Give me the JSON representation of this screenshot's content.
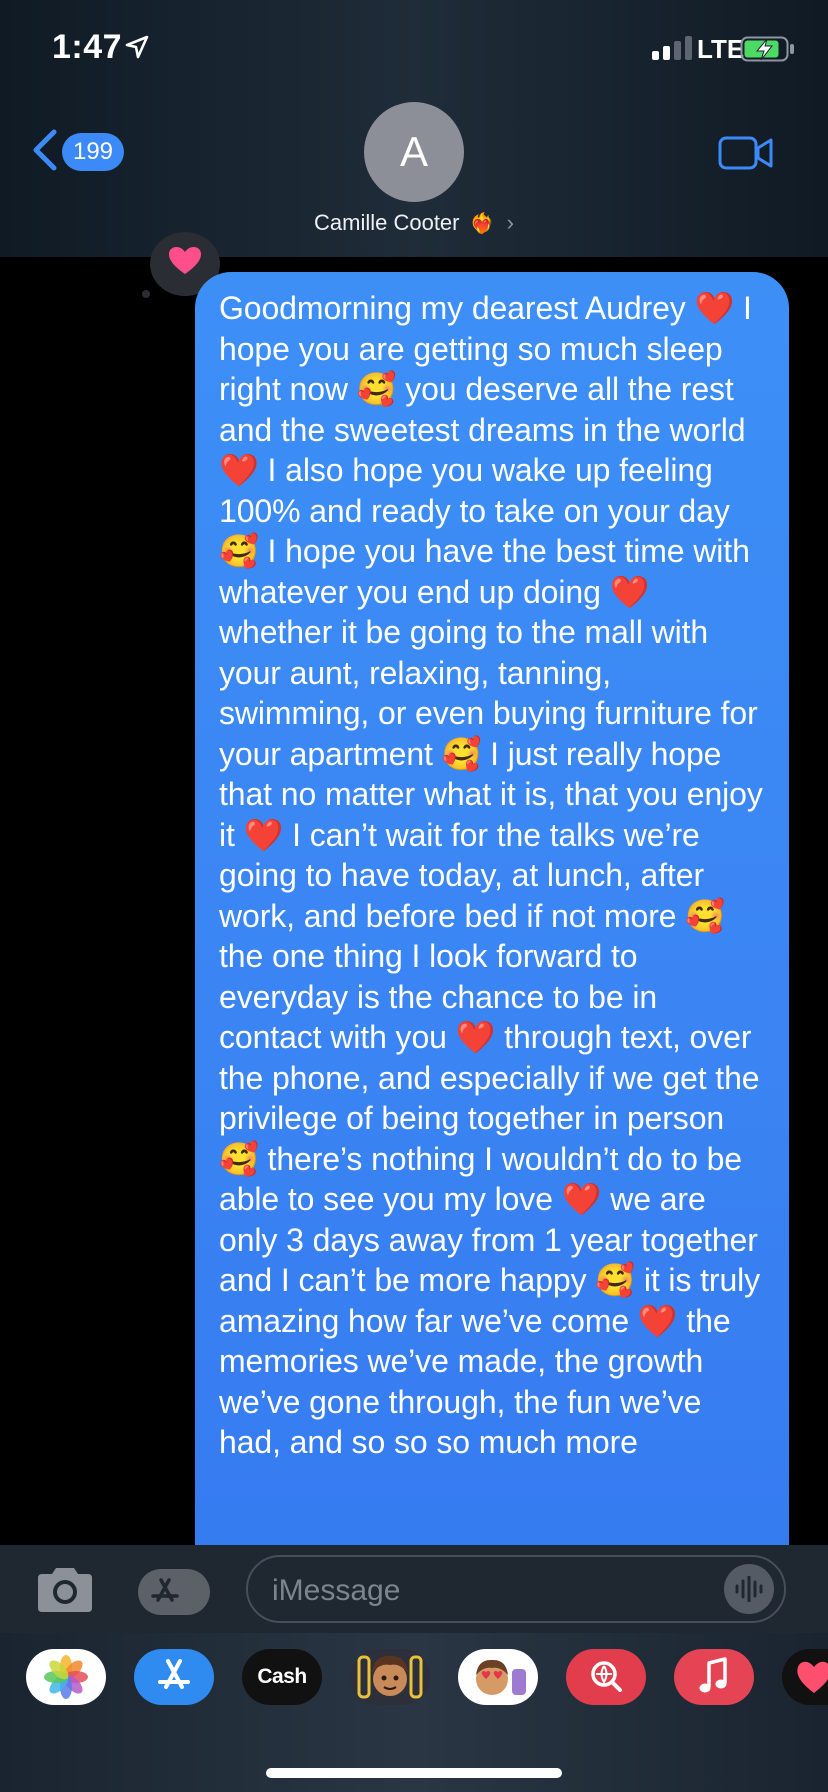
{
  "status_bar": {
    "time": "1:47",
    "network": "LTE"
  },
  "header": {
    "back_count": "199",
    "avatar_initial": "A",
    "contact_name": "Camille Cooter",
    "name_emoji": "❤️‍🔥",
    "chevron": "›"
  },
  "message": {
    "reaction": "heart",
    "text": "Goodmorning my dearest Audrey ❤️ I hope you are getting so much sleep right now 🥰 you deserve all the rest and the sweetest dreams in the world ❤️ I also hope you wake up feeling 100% and ready to take on your day 🥰 I hope you have the best time with whatever you end up doing ❤️ whether it be going to the mall with your aunt, relaxing, tanning, swimming, or even buying furniture for your apartment 🥰 I just really hope that no matter what it is, that you enjoy it ❤️ I can’t wait for the talks we’re going to have today, at lunch, after work, and before bed if not more 🥰 the one thing I look forward to everyday is the chance to be in contact with you ❤️ through text, over the phone, and especially if we get the privilege of being together in person 🥰 there’s nothing I wouldn’t do to be able to see you my love ❤️ we are only 3 days away from 1 year together and I can’t be more happy 🥰 it is truly amazing how far we’ve come ❤️ the memories we’ve made, the growth we’ve gone through, the fun we’ve had, and so so so much more"
  },
  "input": {
    "placeholder": "iMessage"
  },
  "app_tray": {
    "items": [
      {
        "name": "Photos",
        "icon": "photos-icon"
      },
      {
        "name": "App Store",
        "icon": "app-store-icon"
      },
      {
        "name": "Cash",
        "label": "Cash",
        "icon": "apple-cash-icon"
      },
      {
        "name": "Memoji",
        "icon": "memoji-icon"
      },
      {
        "name": "Memoji Stickers",
        "icon": "memoji-stickers-icon"
      },
      {
        "name": "Search Images",
        "icon": "image-search-icon"
      },
      {
        "name": "Music",
        "icon": "music-icon"
      },
      {
        "name": "Digital Touch",
        "icon": "heart-icon"
      }
    ]
  },
  "colors": {
    "bubble": "#3a86f4",
    "accent": "#3c8af7",
    "background": "#000000"
  }
}
